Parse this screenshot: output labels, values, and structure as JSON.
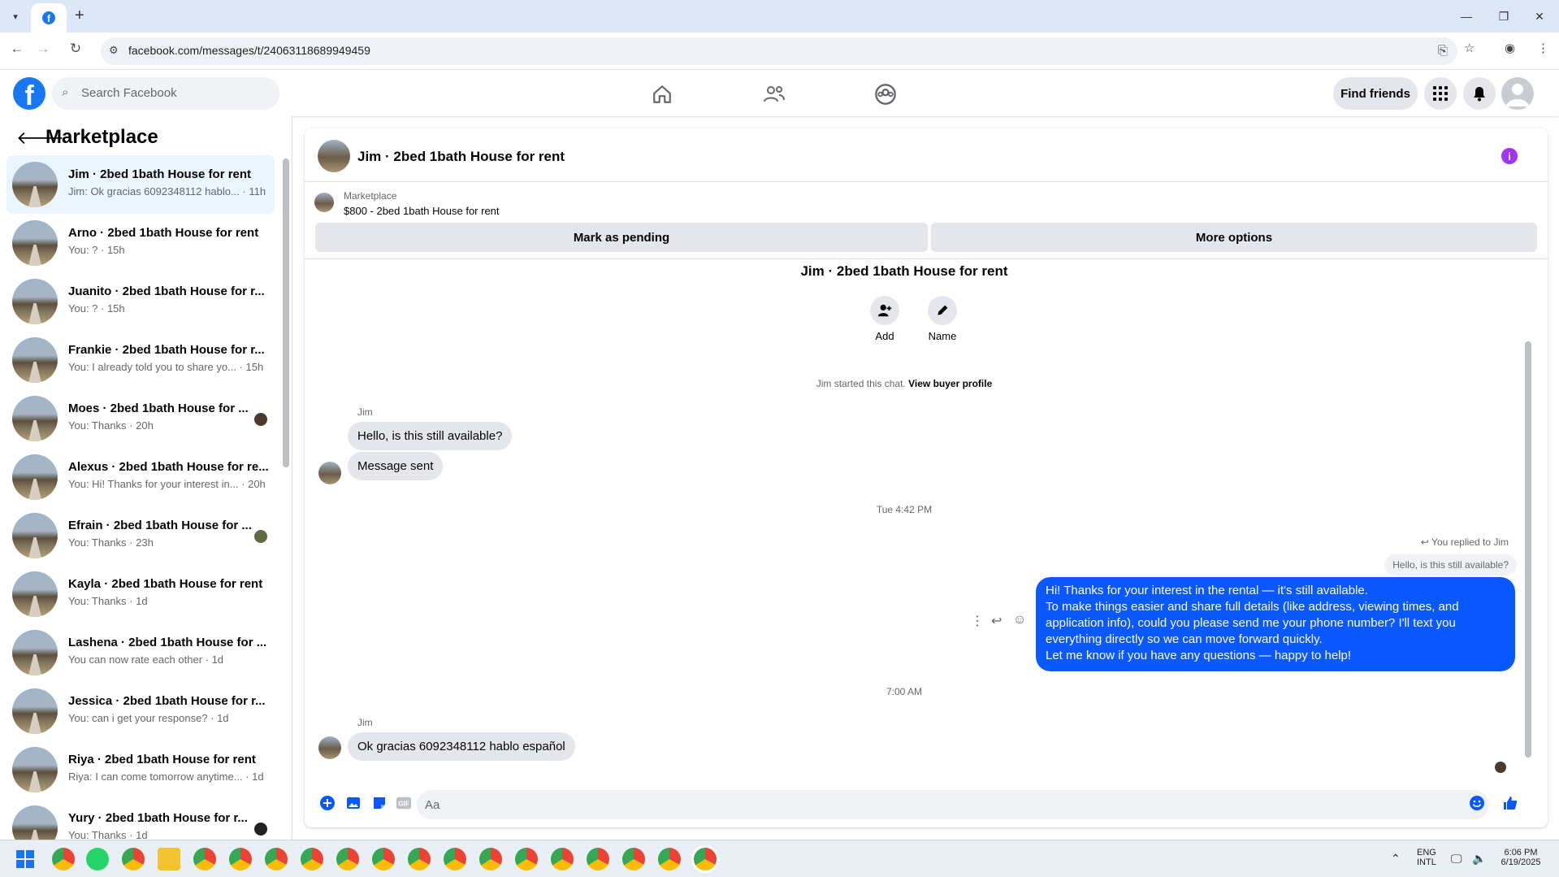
{
  "browser": {
    "url": "facebook.com/messages/t/24063118689949459"
  },
  "fbheader": {
    "search_placeholder": "Search Facebook",
    "find_friends": "Find friends"
  },
  "sidebar": {
    "title": "Marketplace",
    "conversations": [
      {
        "name": "Jim · 2bed 1bath House for rent",
        "preview": "Jim: Ok gracias 6092348112 hablo... · 11h",
        "active": true
      },
      {
        "name": "Arno · 2bed 1bath House for rent",
        "preview": "You: ? · 15h"
      },
      {
        "name": "Juanito · 2bed 1bath House for r...",
        "preview": "You: ? · 15h"
      },
      {
        "name": "Frankie · 2bed 1bath House for r...",
        "preview": "You: I already told you to share yo... · 15h"
      },
      {
        "name": "Moes · 2bed 1bath House for ...",
        "preview": "You: Thanks · 20h"
      },
      {
        "name": "Alexus · 2bed 1bath House for re...",
        "preview": "You: Hi! Thanks for your interest in... · 20h"
      },
      {
        "name": "Efrain · 2bed 1bath House for ...",
        "preview": "You: Thanks · 23h"
      },
      {
        "name": "Kayla · 2bed 1bath House for rent",
        "preview": "You: Thanks · 1d"
      },
      {
        "name": "Lashena · 2bed 1bath House for ...",
        "preview": "You can now rate each other · 1d"
      },
      {
        "name": "Jessica · 2bed 1bath House for r...",
        "preview": "You: can i get your response? · 1d"
      },
      {
        "name": "Riya · 2bed 1bath House for rent",
        "preview": "Riya: I can come tomorrow anytime... · 1d"
      },
      {
        "name": "Yury · 2bed 1bath House for r...",
        "preview": "You: Thanks · 1d"
      }
    ]
  },
  "chat": {
    "title": "Jim · 2bed 1bath House for rent",
    "marketplace_label": "Marketplace",
    "listing": "$800 - 2bed 1bath House for rent",
    "mark_pending": "Mark as pending",
    "more_options": "More options",
    "conv_title": "Jim · 2bed 1bath House for rent",
    "add_label": "Add",
    "name_label": "Name",
    "started_text": "Jim started this chat.",
    "view_buyer": "View buyer profile",
    "sender1": "Jim",
    "msg1": "Hello, is this still available?",
    "msg2": "Message sent",
    "ts1": "Tue 4:42 PM",
    "replied_to": "You replied to Jim",
    "quoted": "Hello, is this still available?",
    "my_msg": [
      "Hi! Thanks for your interest in the rental — it's still available.",
      "To make things easier and share full details (like address, viewing times, and",
      "application info), could you please send me your phone number? I'll text you",
      "everything directly so we can move forward quickly.",
      "Let me know if you have any questions — happy to help!"
    ],
    "ts2": "7:00 AM",
    "sender2": "Jim",
    "msg3": "Ok gracias 6092348112 hablo español",
    "composer_placeholder": "Aa"
  },
  "taskbar": {
    "lang1": "ENG",
    "lang2": "INTL",
    "time": "6:06 PM",
    "date": "6/19/2025"
  }
}
